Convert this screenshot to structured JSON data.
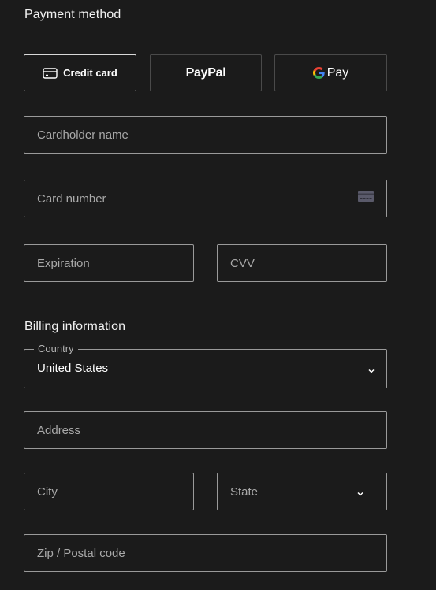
{
  "payment": {
    "title": "Payment method",
    "methods": [
      {
        "id": "credit-card",
        "label": "Credit card",
        "icon": "credit-card-icon",
        "selected": true
      },
      {
        "id": "paypal",
        "label": "PayPal",
        "icon": "paypal-logo",
        "selected": false
      },
      {
        "id": "gpay",
        "label": "Pay",
        "icon": "google-g-icon",
        "selected": false
      }
    ],
    "cardholder_placeholder": "Cardholder name",
    "card_number_placeholder": "Card number",
    "expiration_placeholder": "Expiration",
    "cvv_placeholder": "CVV"
  },
  "billing": {
    "title": "Billing information",
    "country_label": "Country",
    "country_value": "United States",
    "address_placeholder": "Address",
    "city_placeholder": "City",
    "state_placeholder": "State",
    "zip_placeholder": "Zip / Postal code"
  },
  "colors": {
    "background": "#1b1b1b",
    "field_border": "#9a9a9a",
    "selected_border": "#d8d8d8",
    "google_blue": "#4285F4",
    "google_red": "#EA4335",
    "google_yellow": "#FBBC05",
    "google_green": "#34A853"
  }
}
